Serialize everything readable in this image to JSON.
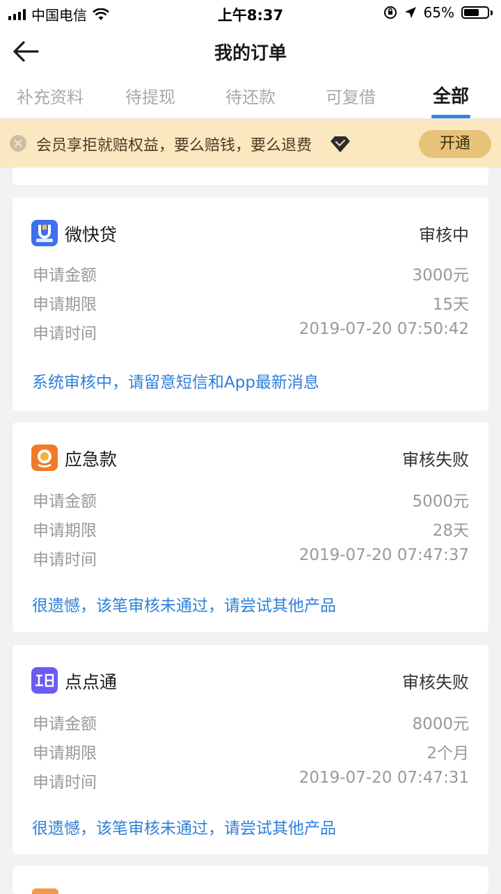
{
  "status_bar": {
    "carrier": "中国电信",
    "time": "上午8:37",
    "battery": "65%",
    "battery_level": 0.65
  },
  "nav": {
    "title": "我的订单",
    "back_icon": "back-arrow-icon"
  },
  "tabs": [
    {
      "label": "补充资料",
      "active": false
    },
    {
      "label": "待提现",
      "active": false
    },
    {
      "label": "待还款",
      "active": false
    },
    {
      "label": "可复借",
      "active": false
    },
    {
      "label": "全部",
      "active": true
    }
  ],
  "banner": {
    "text": "会员享拒就赔权益，要么赔钱，要么退费",
    "button": "开通",
    "icon": "diamond-icon"
  },
  "labels": {
    "amount": "申请金额",
    "term": "申请期限",
    "time": "申请时间"
  },
  "orders": [
    {
      "name": "微快贷",
      "status": "审核中",
      "amount": "3000元",
      "term": "15天",
      "time": "2019-07-20 07:50:42",
      "message": "系统审核中，请留意短信和App最新消息",
      "icon_color": "#3d6ff0"
    },
    {
      "name": "应急款",
      "status": "审核失败",
      "amount": "5000元",
      "term": "28天",
      "time": "2019-07-20 07:47:37",
      "message": "很遗憾，该笔审核未通过，请尝试其他产品",
      "icon_color": "#f07a2a"
    },
    {
      "name": "点点通",
      "status": "审核失败",
      "amount": "8000元",
      "term": "2个月",
      "time": "2019-07-20 07:47:31",
      "message": "很遗憾，该笔审核未通过，请尝试其他产品",
      "icon_color": "#6a5cf0"
    }
  ],
  "colors": {
    "accent": "#2f86e8",
    "banner_bg": "#fbe8c1",
    "banner_button": "#e8c278",
    "link": "#2f7fd8"
  }
}
